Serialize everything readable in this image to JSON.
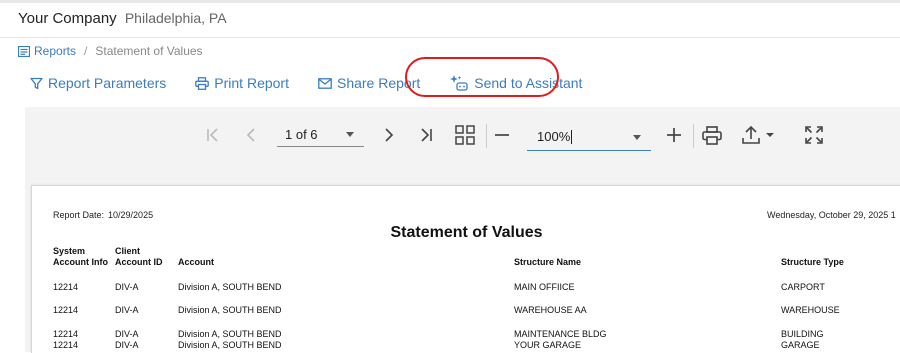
{
  "header": {
    "company": "Your Company",
    "location": "Philadelphia, PA"
  },
  "breadcrumb": {
    "reports_label": "Reports",
    "separator": "/",
    "current": "Statement of Values"
  },
  "actions": {
    "report_parameters": "Report Parameters",
    "print_report": "Print Report",
    "share_report": "Share Report",
    "send_to_assistant": "Send to Assistant"
  },
  "colors": {
    "accent": "#3a7dc0",
    "highlight": "#e01b1b"
  },
  "toolbar": {
    "icons": [
      "first-page-icon",
      "previous-page-icon",
      "next-page-icon",
      "last-page-icon",
      "multi-page-icon",
      "zoom-out-icon",
      "zoom-in-icon",
      "print-icon",
      "export-icon",
      "fullscreen-icon"
    ],
    "page_value": "1 of 6",
    "zoom_value": "100%"
  },
  "report": {
    "report_date_label": "Report Date:",
    "report_date_value": "10/29/2025",
    "day_text": "Wednesday, October 29, 2025 1",
    "title": "Statement of Values",
    "columns": {
      "system_account_info": "System Account Info",
      "client_account_id": "Client Account ID",
      "account": "Account",
      "structure_name": "Structure Name",
      "structure_type": "Structure Type"
    },
    "rows": [
      {
        "system": "12214",
        "client": "DIV-A",
        "account": "Division A, SOUTH BEND",
        "structure_name": "MAIN OFFIICE",
        "structure_type": "CARPORT"
      },
      {
        "system": "12214",
        "client": "DIV-A",
        "account": "Division A, SOUTH BEND",
        "structure_name": "WAREHOUSE AA",
        "structure_type": "WAREHOUSE"
      },
      {
        "system": "12214",
        "client": "DIV-A",
        "account": "Division A, SOUTH BEND",
        "structure_name": "MAINTENANCE BLDG",
        "structure_type": "BUILDING"
      },
      {
        "system": "12214",
        "client": "DIV-A",
        "account": "Division A, SOUTH BEND",
        "structure_name": "YOUR GARAGE",
        "structure_type": "GARAGE"
      }
    ]
  }
}
